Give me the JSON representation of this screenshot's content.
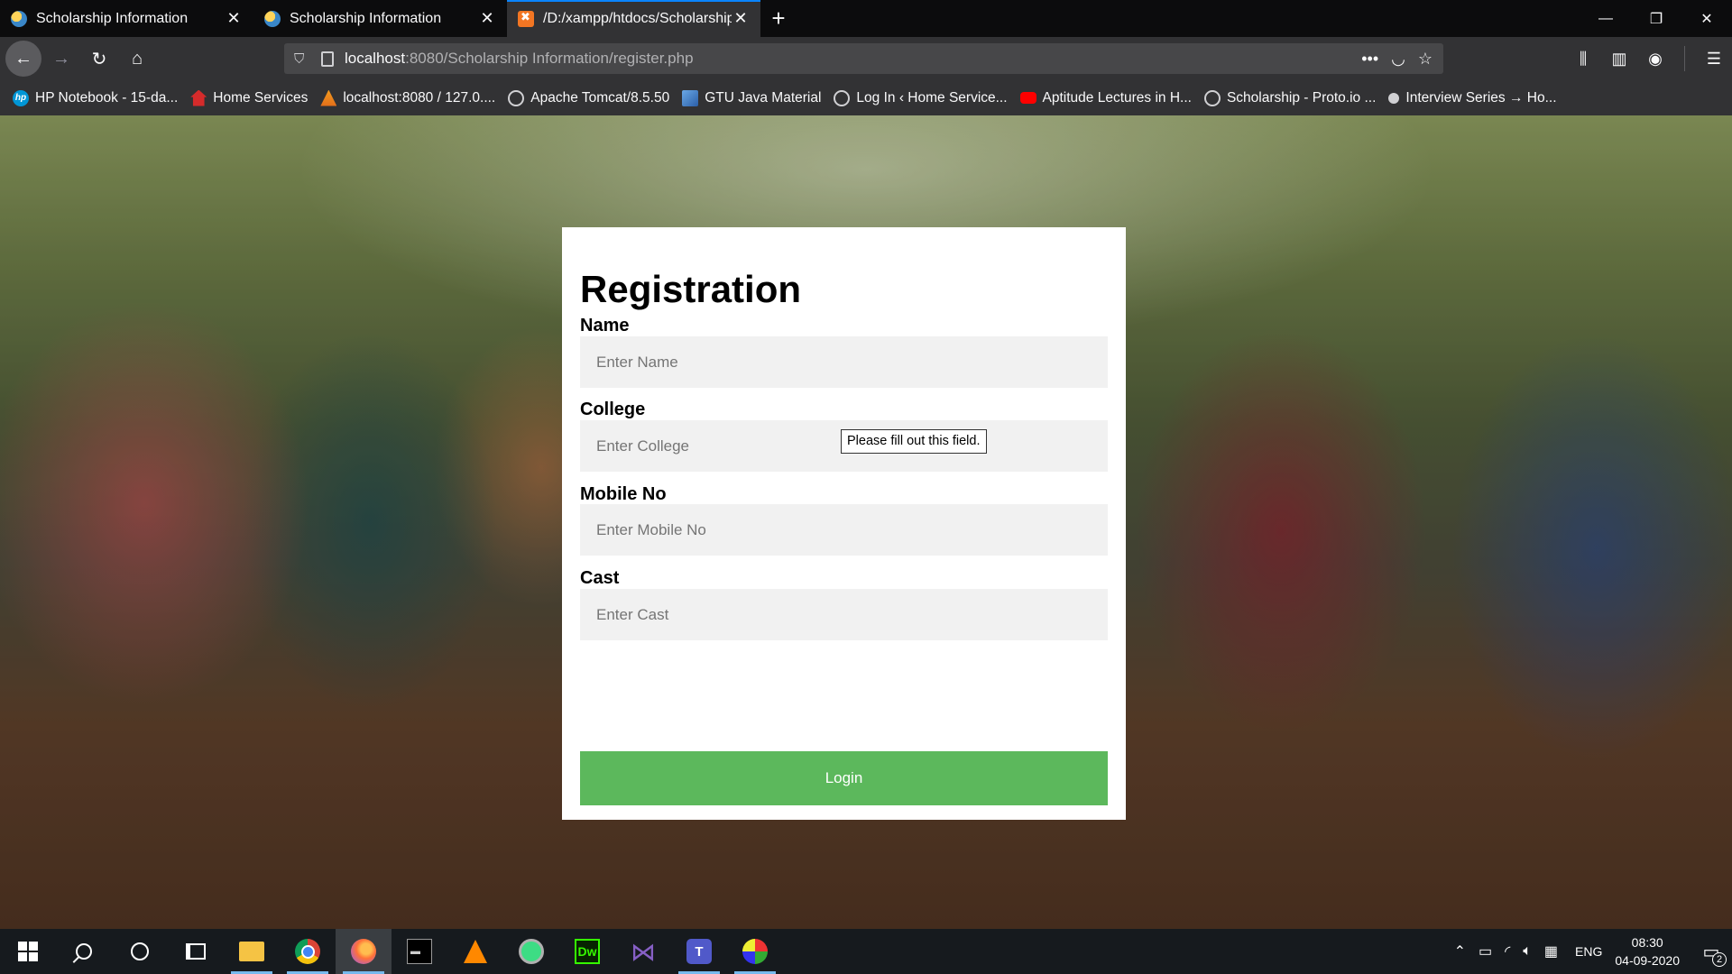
{
  "browser": {
    "tabs": [
      {
        "title": "Scholarship Information",
        "favicon": "globe-favicon",
        "active": false
      },
      {
        "title": "Scholarship Information",
        "favicon": "globe-favicon",
        "active": false
      },
      {
        "title": "/D:/xampp/htdocs/Scholarship",
        "favicon": "xampp-favicon",
        "active": true
      }
    ],
    "new_tab": "+",
    "url_host": "localhost",
    "url_path": ":8080/Scholarship Information/register.php",
    "bookmarks": [
      {
        "label": "HP Notebook - 15-da...",
        "icon": "hp-icon"
      },
      {
        "label": "Home Services",
        "icon": "home-icon"
      },
      {
        "label": "localhost:8080 / 127.0....",
        "icon": "tomcat-icon"
      },
      {
        "label": "Apache Tomcat/8.5.50",
        "icon": "globe-icon"
      },
      {
        "label": "GTU Java Material",
        "icon": "image-icon"
      },
      {
        "label": "Log In ‹ Home Service...",
        "icon": "globe-icon"
      },
      {
        "label": "Aptitude Lectures in H...",
        "icon": "youtube-icon"
      },
      {
        "label": "Scholarship - Proto.io ...",
        "icon": "globe-icon"
      },
      {
        "label": "Interview Series → Ho...",
        "icon": "dot-icon"
      }
    ]
  },
  "form": {
    "title": "Registration",
    "fields": [
      {
        "label": "Name",
        "placeholder": "Enter Name",
        "value": ""
      },
      {
        "label": "College",
        "placeholder": "Enter College",
        "value": ""
      },
      {
        "label": "Mobile No",
        "placeholder": "Enter Mobile No",
        "value": ""
      },
      {
        "label": "Cast",
        "placeholder": "Enter Cast",
        "value": ""
      }
    ],
    "submit_label": "Login",
    "validation_tooltip": "Please fill out this field.",
    "colors": {
      "submit": "#5cb85c",
      "input_bg": "#f1f1f1"
    }
  },
  "taskbar": {
    "apps": [
      {
        "name": "file-explorer",
        "running": true
      },
      {
        "name": "chrome",
        "running": true
      },
      {
        "name": "firefox",
        "running": true,
        "active": true
      },
      {
        "name": "command-prompt",
        "running": false
      },
      {
        "name": "vlc",
        "running": false
      },
      {
        "name": "android-studio",
        "running": false
      },
      {
        "name": "dreamweaver",
        "running": false
      },
      {
        "name": "visual-studio",
        "running": false
      },
      {
        "name": "teams",
        "running": true
      },
      {
        "name": "paint",
        "running": true
      }
    ],
    "dw_label": "Dw",
    "teams_label": "T",
    "language": "ENG",
    "time": "08:30",
    "date": "04-09-2020",
    "notification_count": "2"
  }
}
